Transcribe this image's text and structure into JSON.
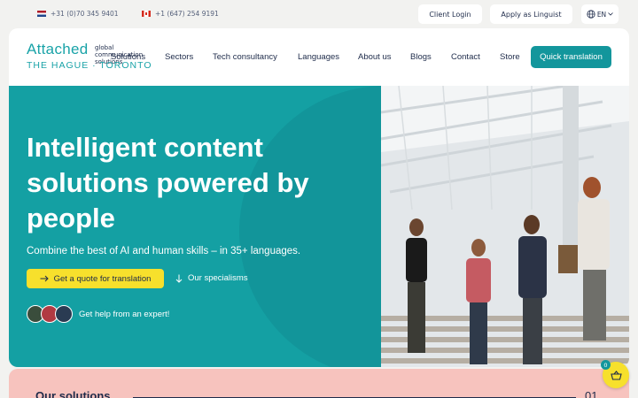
{
  "topbar": {
    "phone_nl": "+31 (0)70 345 9401",
    "phone_ca": "+1 (647) 254 9191",
    "client_login": "Client Login",
    "apply_linguist": "Apply as Linguist",
    "language": "EN"
  },
  "logo": {
    "main": "Attached",
    "sub": "global communication solutions",
    "cities": "THE HAGUE · TORONTO"
  },
  "nav": {
    "items": [
      "Solutions",
      "Sectors",
      "Tech consultancy",
      "Languages",
      "About us",
      "Blogs",
      "Contact",
      "Store"
    ],
    "cta": "Quick translation"
  },
  "hero": {
    "title": "Intelligent content solutions powered by people",
    "subtitle": "Combine the best of AI and human skills – in 35+ languages.",
    "quote_button": "Get a quote for translation",
    "specialisms_link": "Our specialisms",
    "help_text": "Get help from an expert!"
  },
  "solutions": {
    "title": "Our solutions",
    "number": "01"
  },
  "cart": {
    "count": "0"
  },
  "colors": {
    "teal": "#14a0a3",
    "yellow": "#f7e02c",
    "navy": "#1e2b4a",
    "salmon": "#f7c3be"
  }
}
